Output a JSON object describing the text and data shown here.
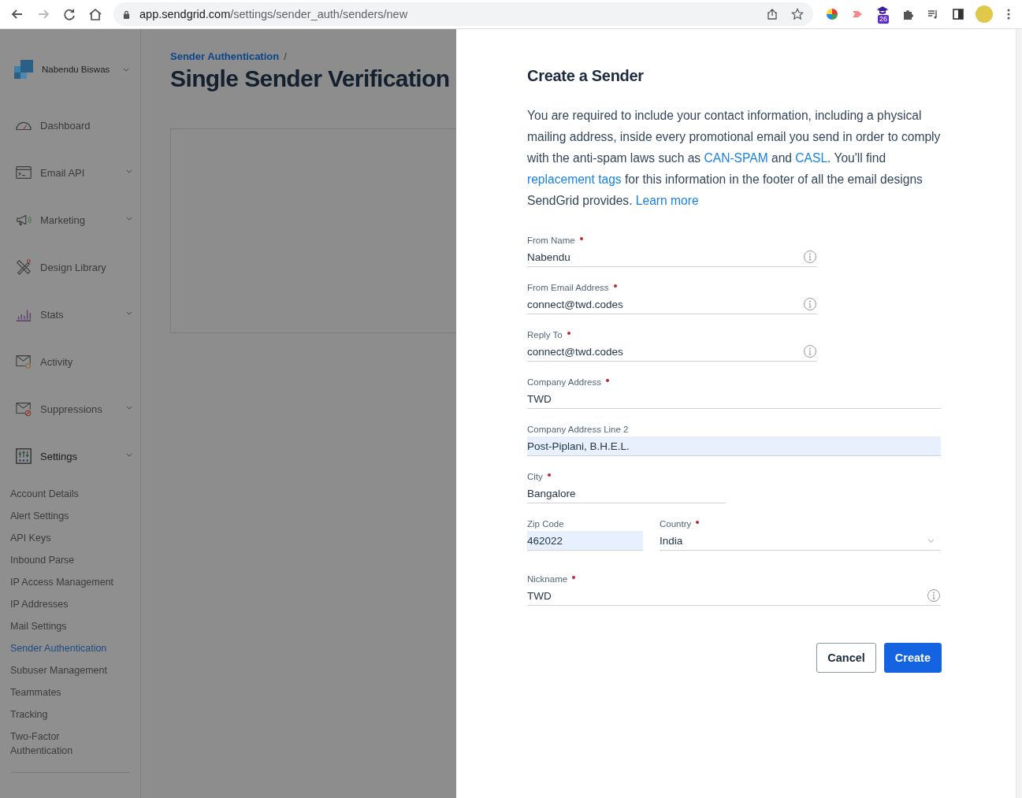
{
  "browser": {
    "url_host": "app.sendgrid.com",
    "url_path": "/settings/sender_auth/senders/new",
    "extension_badge": "26"
  },
  "sidebar": {
    "account_name": "Nabendu Biswas",
    "items": [
      {
        "label": "Dashboard",
        "has_submenu": false,
        "expanded": false
      },
      {
        "label": "Email API",
        "has_submenu": true,
        "expanded": false
      },
      {
        "label": "Marketing",
        "has_submenu": true,
        "expanded": false
      },
      {
        "label": "Design Library",
        "has_submenu": false,
        "expanded": false
      },
      {
        "label": "Stats",
        "has_submenu": true,
        "expanded": false
      },
      {
        "label": "Activity",
        "has_submenu": false,
        "expanded": false
      },
      {
        "label": "Suppressions",
        "has_submenu": true,
        "expanded": false
      },
      {
        "label": "Settings",
        "has_submenu": true,
        "expanded": true,
        "children": [
          {
            "label": "Account Details",
            "selected": false
          },
          {
            "label": "Alert Settings",
            "selected": false
          },
          {
            "label": "API Keys",
            "selected": false
          },
          {
            "label": "Inbound Parse",
            "selected": false
          },
          {
            "label": "IP Access Management",
            "selected": false
          },
          {
            "label": "IP Addresses",
            "selected": false
          },
          {
            "label": "Mail Settings",
            "selected": false
          },
          {
            "label": "Sender Authentication",
            "selected": true
          },
          {
            "label": "Subuser Management",
            "selected": false
          },
          {
            "label": "Teammates",
            "selected": false
          },
          {
            "label": "Tracking",
            "selected": false
          },
          {
            "label": "Two-Factor Authentication",
            "selected": false
          }
        ]
      }
    ]
  },
  "page": {
    "breadcrumb": "Sender Authentication",
    "breadcrumb_separator": "/",
    "title": "Single Sender Verification"
  },
  "panel": {
    "title": "Create a Sender",
    "intro": [
      {
        "text": "You are required to include your contact information, including a physical mailing address, inside every promotional email you send in order to comply with the anti-spam laws such as ",
        "link": false
      },
      {
        "text": "CAN-SPAM",
        "link": true
      },
      {
        "text": " and ",
        "link": false
      },
      {
        "text": "CASL",
        "link": true
      },
      {
        "text": ". You'll find ",
        "link": false
      },
      {
        "text": "replacement tags",
        "link": true
      },
      {
        "text": " for this information in the footer of all the email designs SendGrid provides. ",
        "link": false
      },
      {
        "text": "Learn more",
        "link": true
      }
    ],
    "rows": [
      {
        "fields": [
          {
            "label": "From Name",
            "value": "Nabendu",
            "required": true,
            "autofilled": false,
            "info": true,
            "kind": "text"
          }
        ]
      },
      {
        "fields": [
          {
            "label": "From Email Address",
            "value": "connect@twd.codes",
            "required": true,
            "autofilled": false,
            "info": true,
            "kind": "text"
          }
        ]
      },
      {
        "fields": [
          {
            "label": "Reply To",
            "value": "connect@twd.codes",
            "required": true,
            "autofilled": false,
            "info": true,
            "kind": "text"
          }
        ]
      },
      {
        "fields": [
          {
            "label": "Company Address",
            "value": "TWD",
            "required": true,
            "autofilled": false,
            "info": false,
            "kind": "text"
          }
        ]
      },
      {
        "fields": [
          {
            "label": "Company Address Line 2",
            "value": "Post-Piplani, B.H.E.L.",
            "required": false,
            "autofilled": true,
            "info": false,
            "kind": "text"
          }
        ]
      },
      {
        "fields": [
          {
            "label": "City",
            "value": "Bangalore",
            "required": true,
            "autofilled": false,
            "info": false,
            "kind": "text"
          }
        ]
      },
      {
        "fields": [
          {
            "label": "Zip Code",
            "value": "462022",
            "required": false,
            "autofilled": true,
            "info": false,
            "kind": "text"
          },
          {
            "label": "Country",
            "value": "India",
            "required": true,
            "autofilled": false,
            "info": false,
            "kind": "select"
          }
        ]
      },
      {
        "fields": [
          {
            "label": "Nickname",
            "value": "TWD",
            "required": true,
            "autofilled": false,
            "info": true,
            "kind": "text"
          }
        ]
      }
    ],
    "buttons": [
      {
        "label": "Cancel",
        "kind": "secondary"
      },
      {
        "label": "Create",
        "kind": "primary"
      }
    ]
  }
}
